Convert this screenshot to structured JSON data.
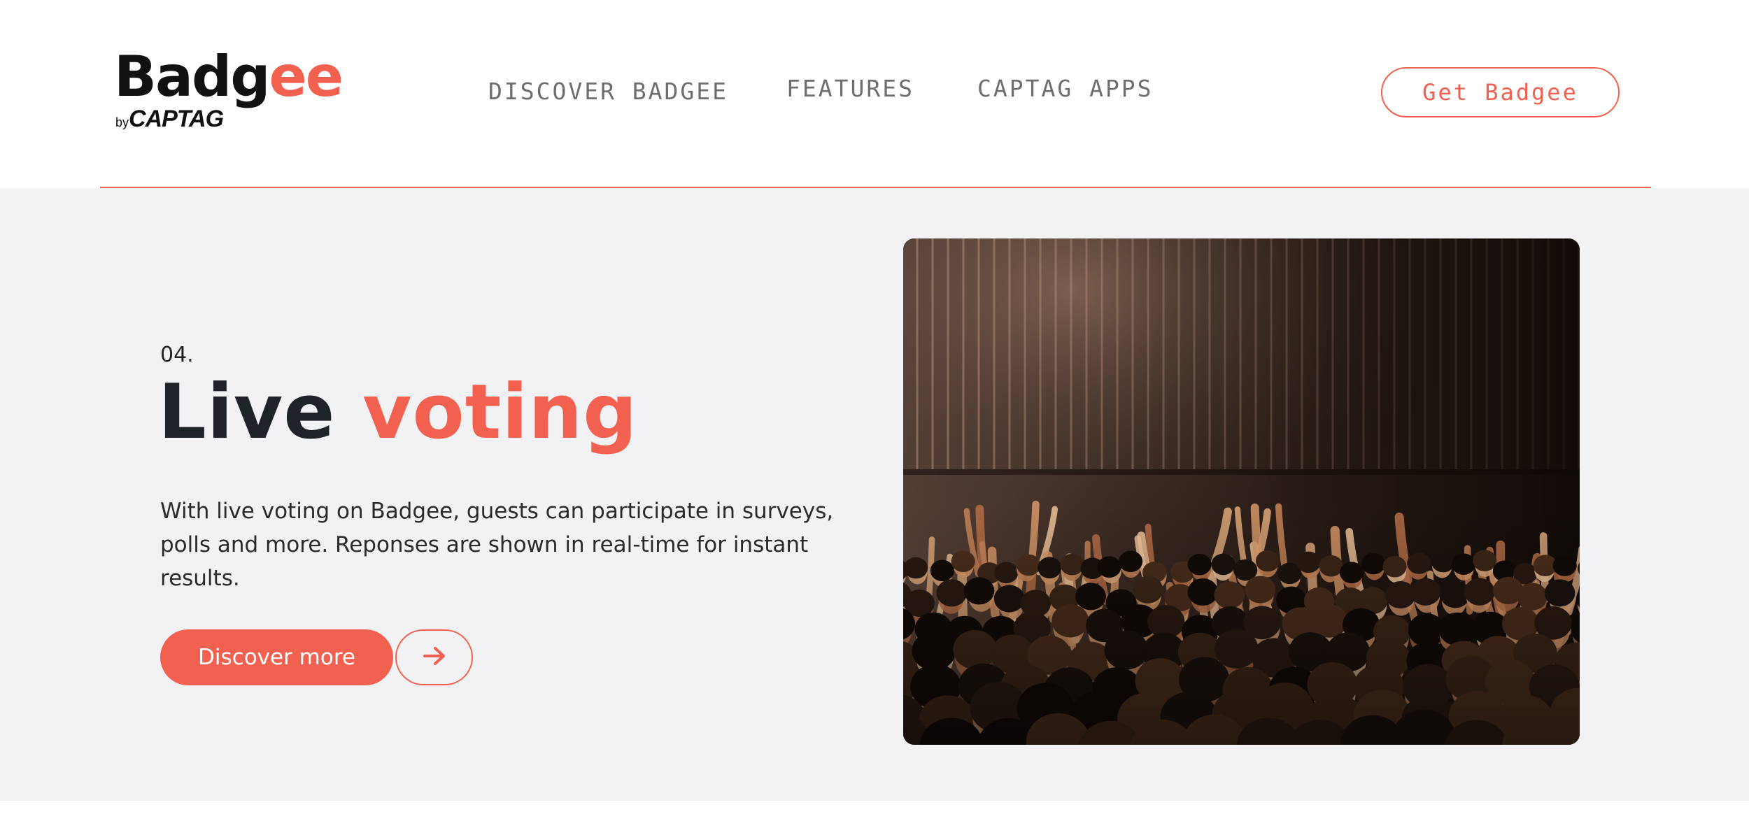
{
  "header": {
    "logo": {
      "main": "Badg",
      "accent": "ee",
      "by_small": "by",
      "by_brand": "CAPTAG"
    },
    "nav": [
      {
        "label": "DISCOVER BADGEE"
      },
      {
        "label": "FEATURES"
      },
      {
        "label": "CAPTAG APPS"
      }
    ],
    "cta_label": "Get Badgee"
  },
  "feature": {
    "number": "04.",
    "title_main": "Live",
    "title_accent": "voting",
    "description": "With live voting on Badgee, guests can participate in surveys, polls and more. Reponses are shown in real-time for instant results.",
    "discover_label": "Discover more",
    "arrow_icon": "arrow-right-icon",
    "image_subject": "crowd-photo"
  },
  "colors": {
    "accent": "#f2604f",
    "dark_text": "#1f2229",
    "nav_text": "#6e6e6e",
    "section_bg": "#f2f2f4"
  }
}
